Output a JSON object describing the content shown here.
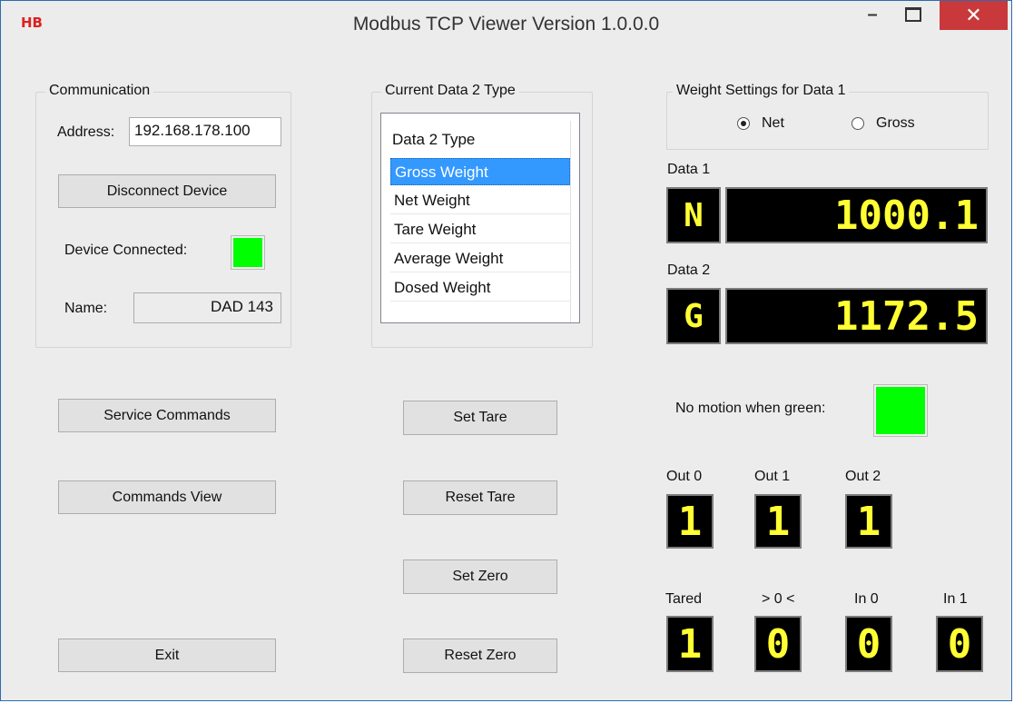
{
  "window": {
    "logo": "HB",
    "title": "Modbus TCP Viewer Version 1.0.0.0",
    "minimize": "–",
    "close": "✕"
  },
  "communication": {
    "legend": "Communication",
    "address_label": "Address:",
    "address_value": "192.168.178.100",
    "disconnect_button": "Disconnect Device",
    "device_connected_label": "Device Connected:",
    "name_label": "Name:",
    "name_value": "DAD 143"
  },
  "data2_type": {
    "legend": "Current Data 2 Type",
    "header": "Data 2 Type",
    "items": [
      "Gross Weight",
      "Net Weight",
      "Tare Weight",
      "Average Weight",
      "Dosed Weight"
    ],
    "selected": "Gross Weight"
  },
  "weight_settings": {
    "legend": "Weight Settings for Data 1",
    "options": [
      "Net",
      "Gross"
    ],
    "selected": "Net"
  },
  "data1": {
    "label": "Data 1",
    "indicator": "N",
    "value": "1000.1"
  },
  "data2": {
    "label": "Data 2",
    "indicator": "G",
    "value": "1172.5"
  },
  "motion": {
    "label": "No motion when green:"
  },
  "buttons": {
    "service_commands": "Service Commands",
    "commands_view": "Commands View",
    "exit": "Exit",
    "set_tare": "Set Tare",
    "reset_tare": "Reset Tare",
    "set_zero": "Set Zero",
    "reset_zero": "Reset Zero"
  },
  "outputs": [
    {
      "label": "Out 0",
      "value": "1"
    },
    {
      "label": "Out 1",
      "value": "1"
    },
    {
      "label": "Out 2",
      "value": "1"
    }
  ],
  "status_bits": [
    {
      "label": "Tared",
      "value": "1"
    },
    {
      "label": "> 0 <",
      "value": "0"
    },
    {
      "label": "In 0",
      "value": "0"
    },
    {
      "label": "In 1",
      "value": "0"
    }
  ],
  "colors": {
    "indicator_on": "#00ff00",
    "led_text": "#ffff33",
    "led_background": "#000000",
    "selection": "#3399ff",
    "close_button": "#c9393b"
  }
}
